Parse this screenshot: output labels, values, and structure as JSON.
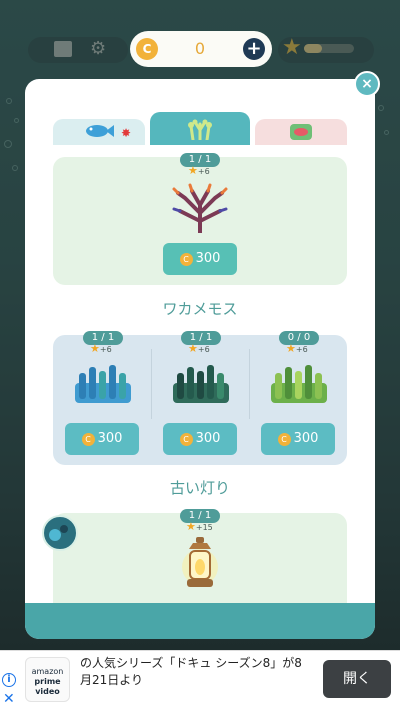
{
  "hud": {
    "coin_symbol": "C",
    "coins": "0",
    "plus_symbol": "+",
    "level_progress": 0.35
  },
  "dialog": {
    "close_symbol": "×",
    "tabs": [
      {
        "name": "fish",
        "icon": "fish-icon",
        "has_new": true
      },
      {
        "name": "plants",
        "icon": "plant-icon",
        "active": true
      },
      {
        "name": "food",
        "icon": "food-icon"
      }
    ],
    "items": [
      {
        "count": "1 / 1",
        "score": "+6",
        "price": "300",
        "icon": "red-coral-icon"
      }
    ],
    "sections": [
      {
        "title": "ワカメモス",
        "items": [
          {
            "count": "1 / 1",
            "score": "+6",
            "price": "300",
            "icon": "blue-moss-icon"
          },
          {
            "count": "1 / 1",
            "score": "+6",
            "price": "300",
            "icon": "dark-green-moss-icon"
          },
          {
            "count": "0 / 0",
            "score": "+6",
            "price": "300",
            "icon": "light-green-moss-icon"
          }
        ]
      },
      {
        "title": "古い灯り",
        "items": [
          {
            "count": "1 / 1",
            "score": "+15",
            "icon": "lantern-icon"
          }
        ]
      }
    ],
    "coin_symbol": "C",
    "star_symbol": "★"
  },
  "ad": {
    "logo_text_1": "amazon",
    "logo_text_2": "prime video",
    "text": "の人気シリーズ「ドキュ シーズン8」が8月21日より",
    "button": "開く",
    "info_symbol": "i",
    "close_symbol": "✕"
  },
  "colors": {
    "accent": "#4f9c99",
    "coin": "#f2b23a",
    "tab_active": "#55b7bd",
    "footer": "#4aa6a8"
  }
}
